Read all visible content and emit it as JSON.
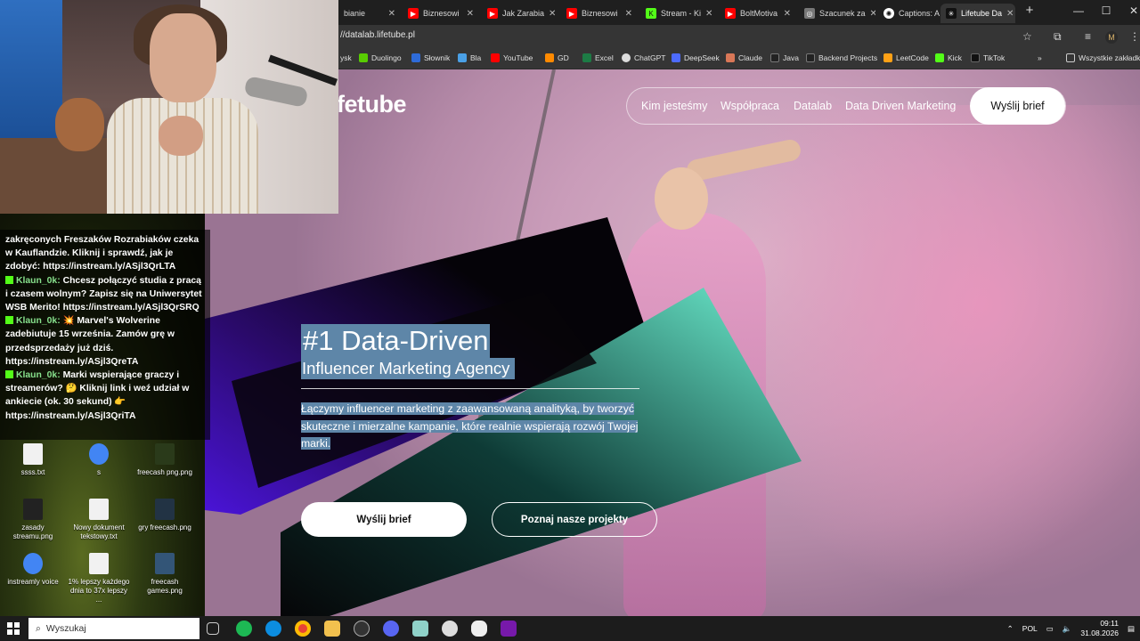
{
  "browser": {
    "tabs": [
      {
        "label": "bianie",
        "color": "#333333"
      },
      {
        "label": "Biznesowi",
        "color": "#ff0000"
      },
      {
        "label": "Jak Zarabia",
        "color": "#ff0000"
      },
      {
        "label": "Biznesowi",
        "color": "#ff0000"
      },
      {
        "label": "Stream - Ki",
        "color": "#53fc18"
      },
      {
        "label": "BoltMotiva",
        "color": "#ff0000"
      },
      {
        "label": "Szacunek za",
        "color": "#888888"
      },
      {
        "label": "Captions: A",
        "color": "#ffffff"
      },
      {
        "label": "Lifetube Da",
        "color": "#111111"
      }
    ],
    "url": "//datalab.lifetube.pl",
    "bookmarks": [
      {
        "label": "ysk",
        "color": "#555555"
      },
      {
        "label": "Duolingo",
        "color": "#58cc02"
      },
      {
        "label": "Słownik",
        "color": "#2e6bd8"
      },
      {
        "label": "Bla",
        "color": "#4aa0e6"
      },
      {
        "label": "YouTube",
        "color": "#ff0000"
      },
      {
        "label": "GD",
        "color": "#ff8a00"
      },
      {
        "label": "Excel",
        "color": "#1d7b45"
      },
      {
        "label": "ChatGPT",
        "color": "#dddddd"
      },
      {
        "label": "DeepSeek",
        "color": "#4d6bfe"
      },
      {
        "label": "Claude",
        "color": "#d97757"
      },
      {
        "label": "Java",
        "color": "#222222"
      },
      {
        "label": "Backend Projects",
        "color": "#222222"
      },
      {
        "label": "LeetCode",
        "color": "#ffa116"
      },
      {
        "label": "Kick",
        "color": "#53fc18"
      },
      {
        "label": "TikTok",
        "color": "#111111"
      }
    ],
    "all_bookmarks": "Wszystkie zakładki"
  },
  "site": {
    "logo": "fetube",
    "nav": [
      "Kim jesteśmy",
      "Współpraca",
      "Datalab",
      "Data Driven Marketing"
    ],
    "nav_cta": "Wyślij brief",
    "hero_title": "#1 Data-Driven",
    "hero_subtitle": "Influencer Marketing Agency",
    "hero_desc_lines": [
      "Łączymy influencer marketing z zaawansowaną analityką, by tworzyć",
      "skuteczne i mierzalne kampanie, które realnie wspierają rozwój Twojej",
      "marki."
    ],
    "btn_brief": "Wyślij brief",
    "btn_projects": "Poznaj nasze projekty"
  },
  "chat": {
    "messages": [
      {
        "user": "",
        "text": "zakręconych Freszaków Rozrabiaków czeka w Kauflandzie. Kliknij i sprawdź, jak je zdobyć: https://instream.ly/ASjl3QrLTA"
      },
      {
        "user": "Klaun_0k:",
        "text": "Chcesz połączyć studia z pracą i czasem wolnym? Zapisz się na Uniwersytet WSB Merito! https://instream.ly/ASjl3QrSRQ"
      },
      {
        "user": "Klaun_0k:",
        "text": "💥 Marvel's Wolverine zadebiutuje 15 września. Zamów grę w przedsprzedaży już dziś. https://instream.ly/ASjl3QreTA"
      },
      {
        "user": "Klaun_0k:",
        "text": "Marki wspierające graczy i streamerów? 🤔 Kliknij link i weź udział w ankiecie (ok. 30 sekund) 👉 https://instream.ly/ASjl3QriTA"
      }
    ]
  },
  "desktop_icons": [
    {
      "label": "ssss.txt",
      "color": "#f1f1f1"
    },
    {
      "label": "s",
      "color": "#4285f4"
    },
    {
      "label": "freecash png.png",
      "color": "#2a3a1a"
    },
    {
      "label": "zasady streamu.png",
      "color": "#222222"
    },
    {
      "label": "Nowy dokument tekstowy.txt",
      "color": "#f1f1f1"
    },
    {
      "label": "gry freecash.png",
      "color": "#223344"
    },
    {
      "label": "instreamly voice",
      "color": "#4285f4"
    },
    {
      "label": "1% lepszy każdego dnia to 37x lepszy ...",
      "color": "#f1f1f1"
    },
    {
      "label": "freecash games.png",
      "color": "#335577"
    }
  ],
  "taskbar": {
    "search_placeholder": "Wyszukaj",
    "lang": "POL",
    "time": "09:11",
    "date": "31.08.2026",
    "apps": [
      "task-view",
      "spotify",
      "edge",
      "chrome",
      "explorer",
      "obs",
      "discord",
      "notepad",
      "clock",
      "app",
      "onenote"
    ]
  }
}
